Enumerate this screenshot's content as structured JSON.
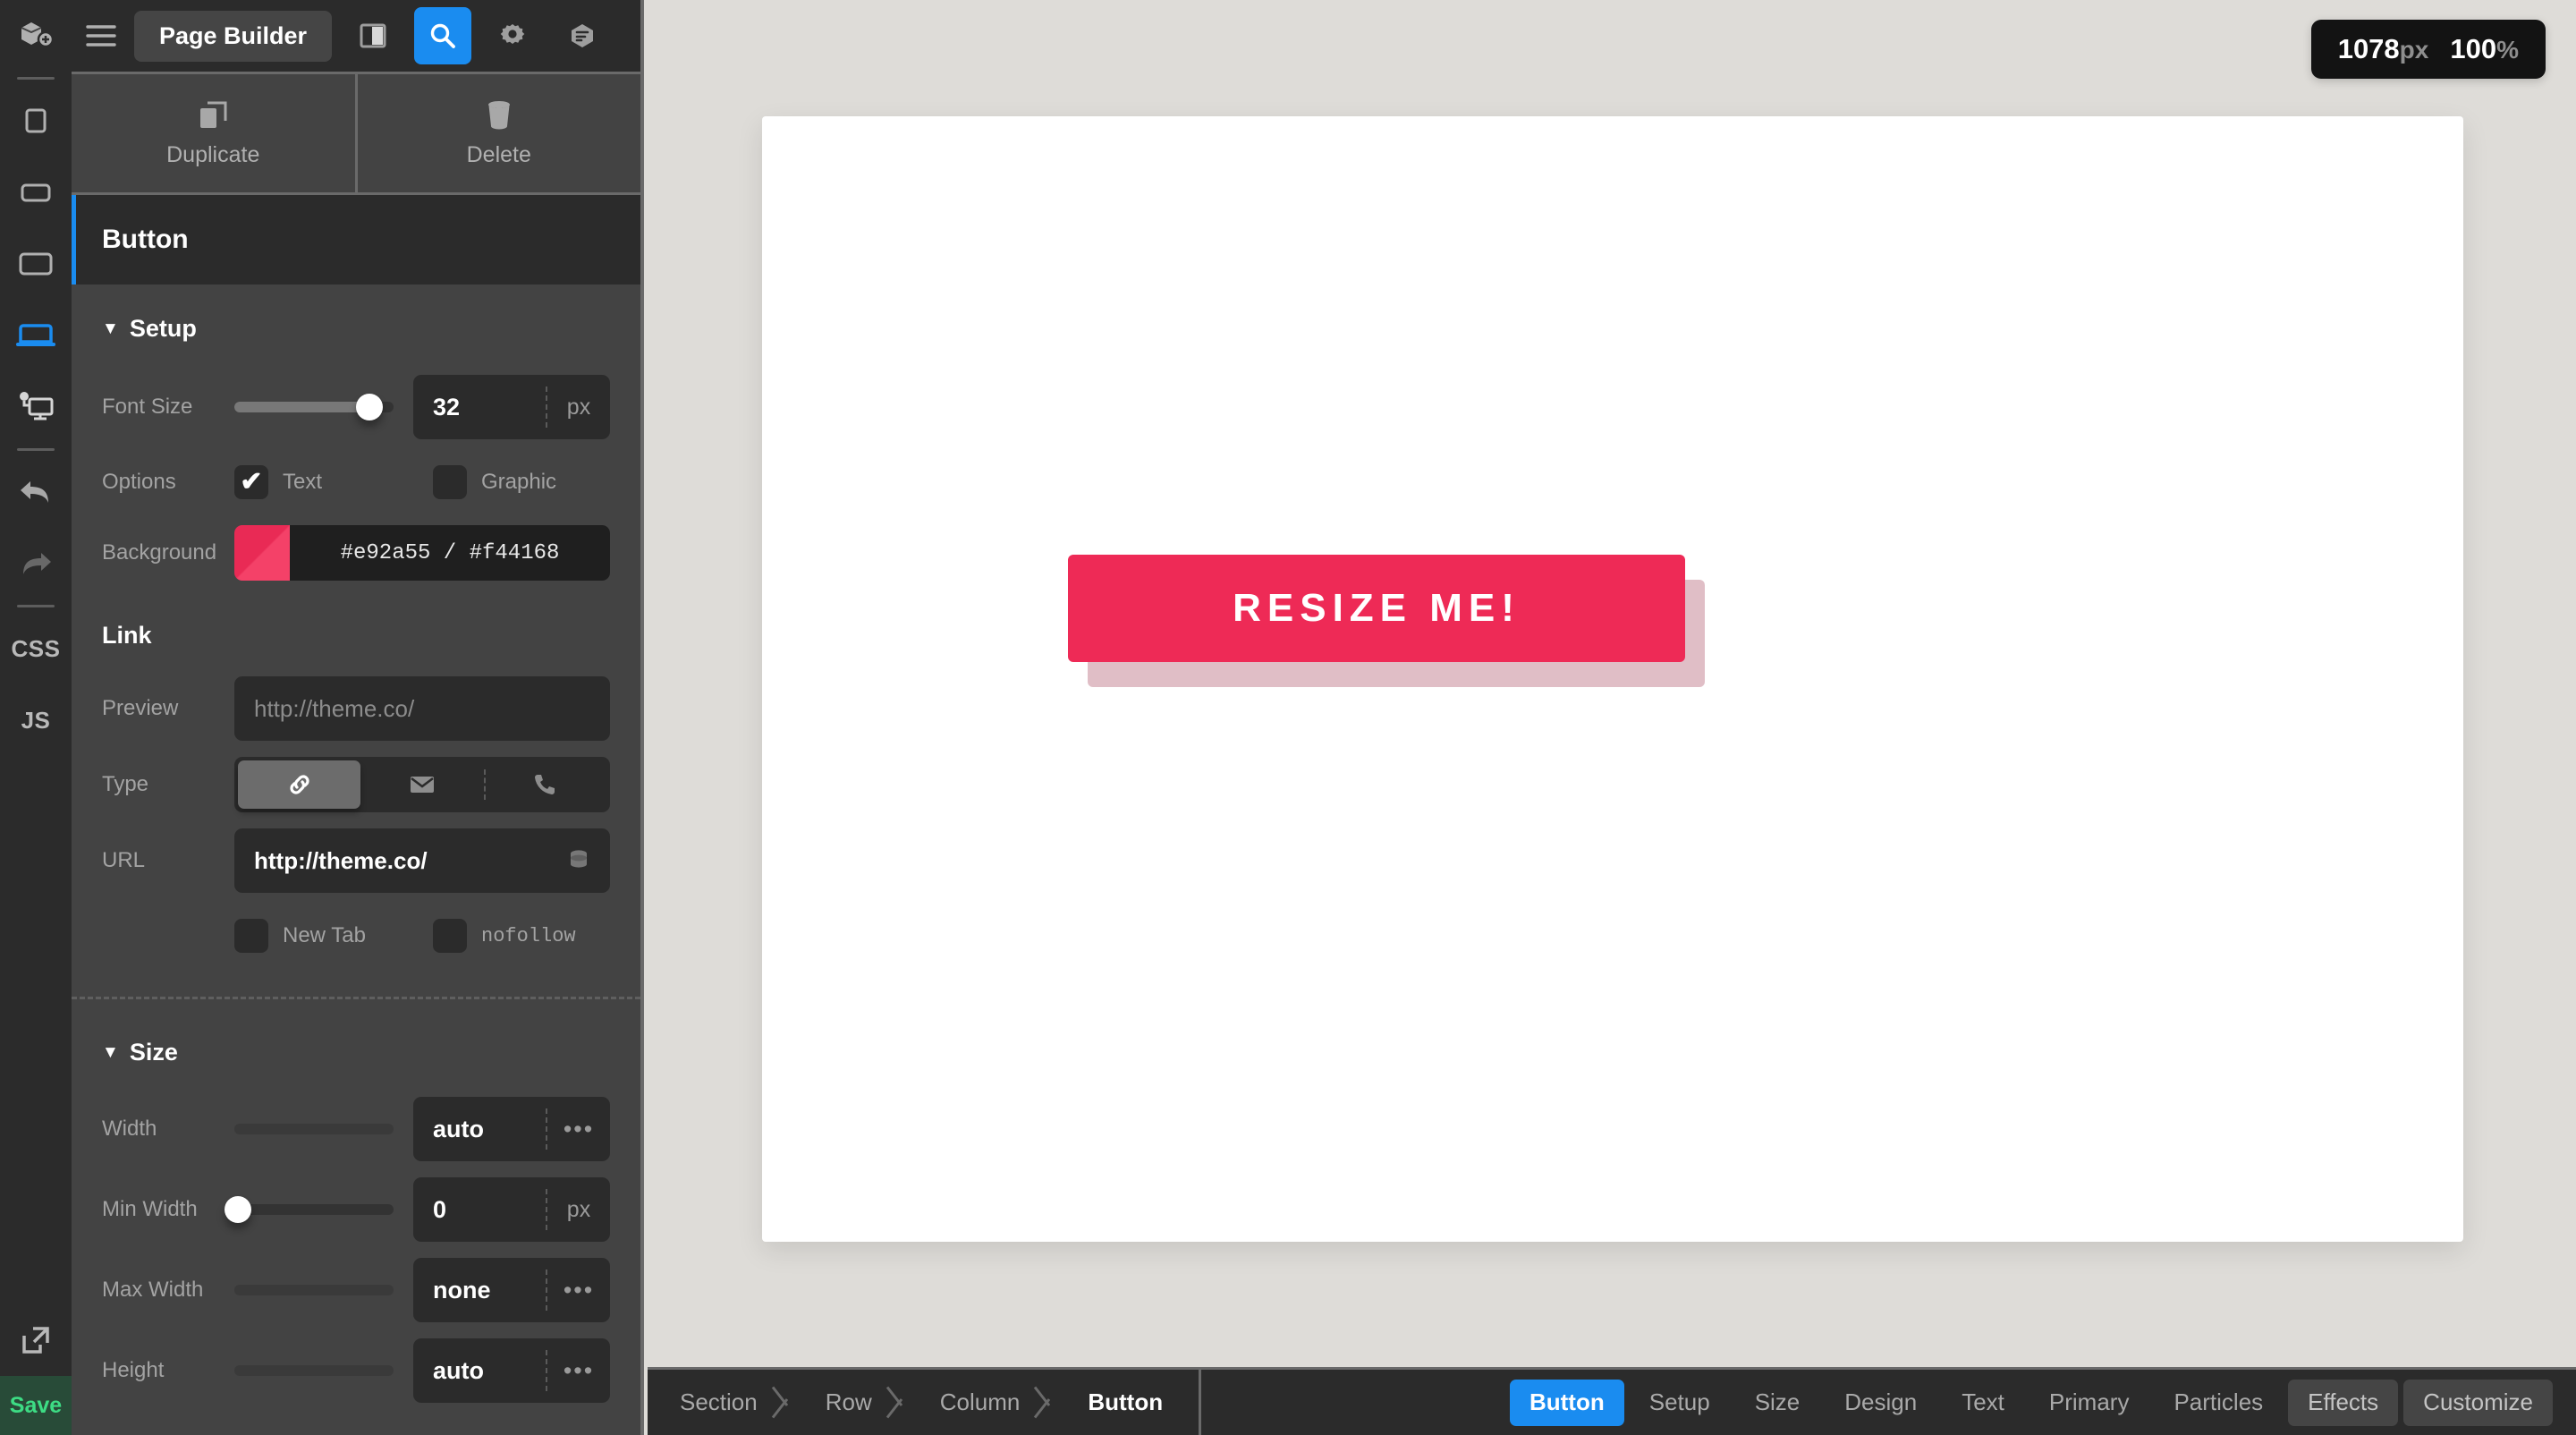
{
  "rail": {
    "items": [
      {
        "id": "add-element",
        "icon": "add-element-icon",
        "label": "Add Element"
      },
      {
        "id": "mobile",
        "icon": "mobile-icon",
        "label": "Mobile"
      },
      {
        "id": "tablet-portrait",
        "icon": "tablet-portrait-icon",
        "label": "Tablet Portrait"
      },
      {
        "id": "tablet-landscape",
        "icon": "tablet-landscape-icon",
        "label": "Tablet Landscape"
      },
      {
        "id": "laptop",
        "icon": "laptop-icon",
        "label": "Laptop"
      },
      {
        "id": "desktop",
        "icon": "desktop-icon",
        "label": "Desktop"
      },
      {
        "id": "undo",
        "icon": "undo-icon",
        "label": "Undo"
      },
      {
        "id": "redo",
        "icon": "redo-icon",
        "label": "Redo"
      }
    ],
    "css_label": "CSS",
    "js_label": "JS",
    "external_link_label": "Open Preview",
    "save_label": "Save",
    "active_device": "laptop",
    "accent_color": "#1a8cf0",
    "save_color": "#3ddc84"
  },
  "panel": {
    "topbar": {
      "menu_icon": "hamburger-icon",
      "title": "Page Builder",
      "tools": [
        {
          "id": "layout",
          "icon": "panel-layout-icon",
          "active": false
        },
        {
          "id": "search",
          "icon": "search-icon",
          "active": true
        },
        {
          "id": "settings",
          "icon": "gear-icon",
          "active": false
        },
        {
          "id": "content",
          "icon": "hexagon-lines-icon",
          "active": false
        }
      ]
    },
    "actions": [
      {
        "id": "duplicate",
        "icon": "duplicate-icon",
        "label": "Duplicate"
      },
      {
        "id": "delete",
        "icon": "trash-icon",
        "label": "Delete"
      }
    ],
    "element_title": "Button",
    "setup": {
      "title": "Setup",
      "caret": "▼",
      "font_size": {
        "label": "Font Size",
        "value": "32",
        "unit": "px",
        "slider_percent": 85
      },
      "options": {
        "label": "Options",
        "items": [
          {
            "label": "Text",
            "checked": true,
            "mark": "✔"
          },
          {
            "label": "Graphic",
            "checked": false,
            "mark": ""
          }
        ]
      },
      "background": {
        "label": "Background",
        "value": "#e92a55 / #f44168",
        "color_a": "#e92a55",
        "color_b": "#f44168"
      }
    },
    "link": {
      "title": "Link",
      "preview": {
        "label": "Preview",
        "placeholder": "http://theme.co/"
      },
      "type": {
        "label": "Type",
        "options": [
          {
            "id": "url",
            "icon": "link-icon",
            "active": true
          },
          {
            "id": "email",
            "icon": "mail-icon",
            "active": false
          },
          {
            "id": "phone",
            "icon": "phone-icon",
            "active": false
          }
        ]
      },
      "url": {
        "label": "URL",
        "value": "http://theme.co/",
        "trailing_icon": "database-icon"
      },
      "flags": [
        {
          "label": "New Tab",
          "checked": false,
          "mono": false
        },
        {
          "label": "nofollow",
          "checked": false,
          "mono": true
        }
      ]
    },
    "size": {
      "title": "Size",
      "caret": "▼",
      "fields": [
        {
          "label": "Width",
          "value": "auto",
          "unit": "•••",
          "unit_is_dots": true,
          "slider_percent": 0,
          "has_knob": false
        },
        {
          "label": "Min Width",
          "value": "0",
          "unit": "px",
          "unit_is_dots": false,
          "slider_percent": 0,
          "has_knob": true
        },
        {
          "label": "Max Width",
          "value": "none",
          "unit": "•••",
          "unit_is_dots": true,
          "slider_percent": 0,
          "has_knob": false
        },
        {
          "label": "Height",
          "value": "auto",
          "unit": "•••",
          "unit_is_dots": true,
          "slider_percent": 0,
          "has_knob": false
        }
      ]
    }
  },
  "stage": {
    "zoom_badge": {
      "width_value": "1078",
      "width_unit": "px",
      "zoom_value": "100",
      "zoom_unit": "%"
    },
    "cta": {
      "text": "RESIZE ME!",
      "bg": "#ee2a56",
      "shadow": "#e0bec6",
      "text_color": "#ffffff"
    }
  },
  "bottom": {
    "breadcrumbs": [
      {
        "label": "Section",
        "active": false
      },
      {
        "label": "Row",
        "active": false
      },
      {
        "label": "Column",
        "active": false
      },
      {
        "label": "Button",
        "active": true
      }
    ],
    "tabs": [
      {
        "label": "Button",
        "style": "primary"
      },
      {
        "label": "Setup",
        "style": "plain"
      },
      {
        "label": "Size",
        "style": "plain"
      },
      {
        "label": "Design",
        "style": "plain"
      },
      {
        "label": "Text",
        "style": "plain"
      },
      {
        "label": "Primary",
        "style": "plain"
      },
      {
        "label": "Particles",
        "style": "plain"
      },
      {
        "label": "Effects",
        "style": "boxed"
      },
      {
        "label": "Customize",
        "style": "boxed"
      }
    ]
  }
}
